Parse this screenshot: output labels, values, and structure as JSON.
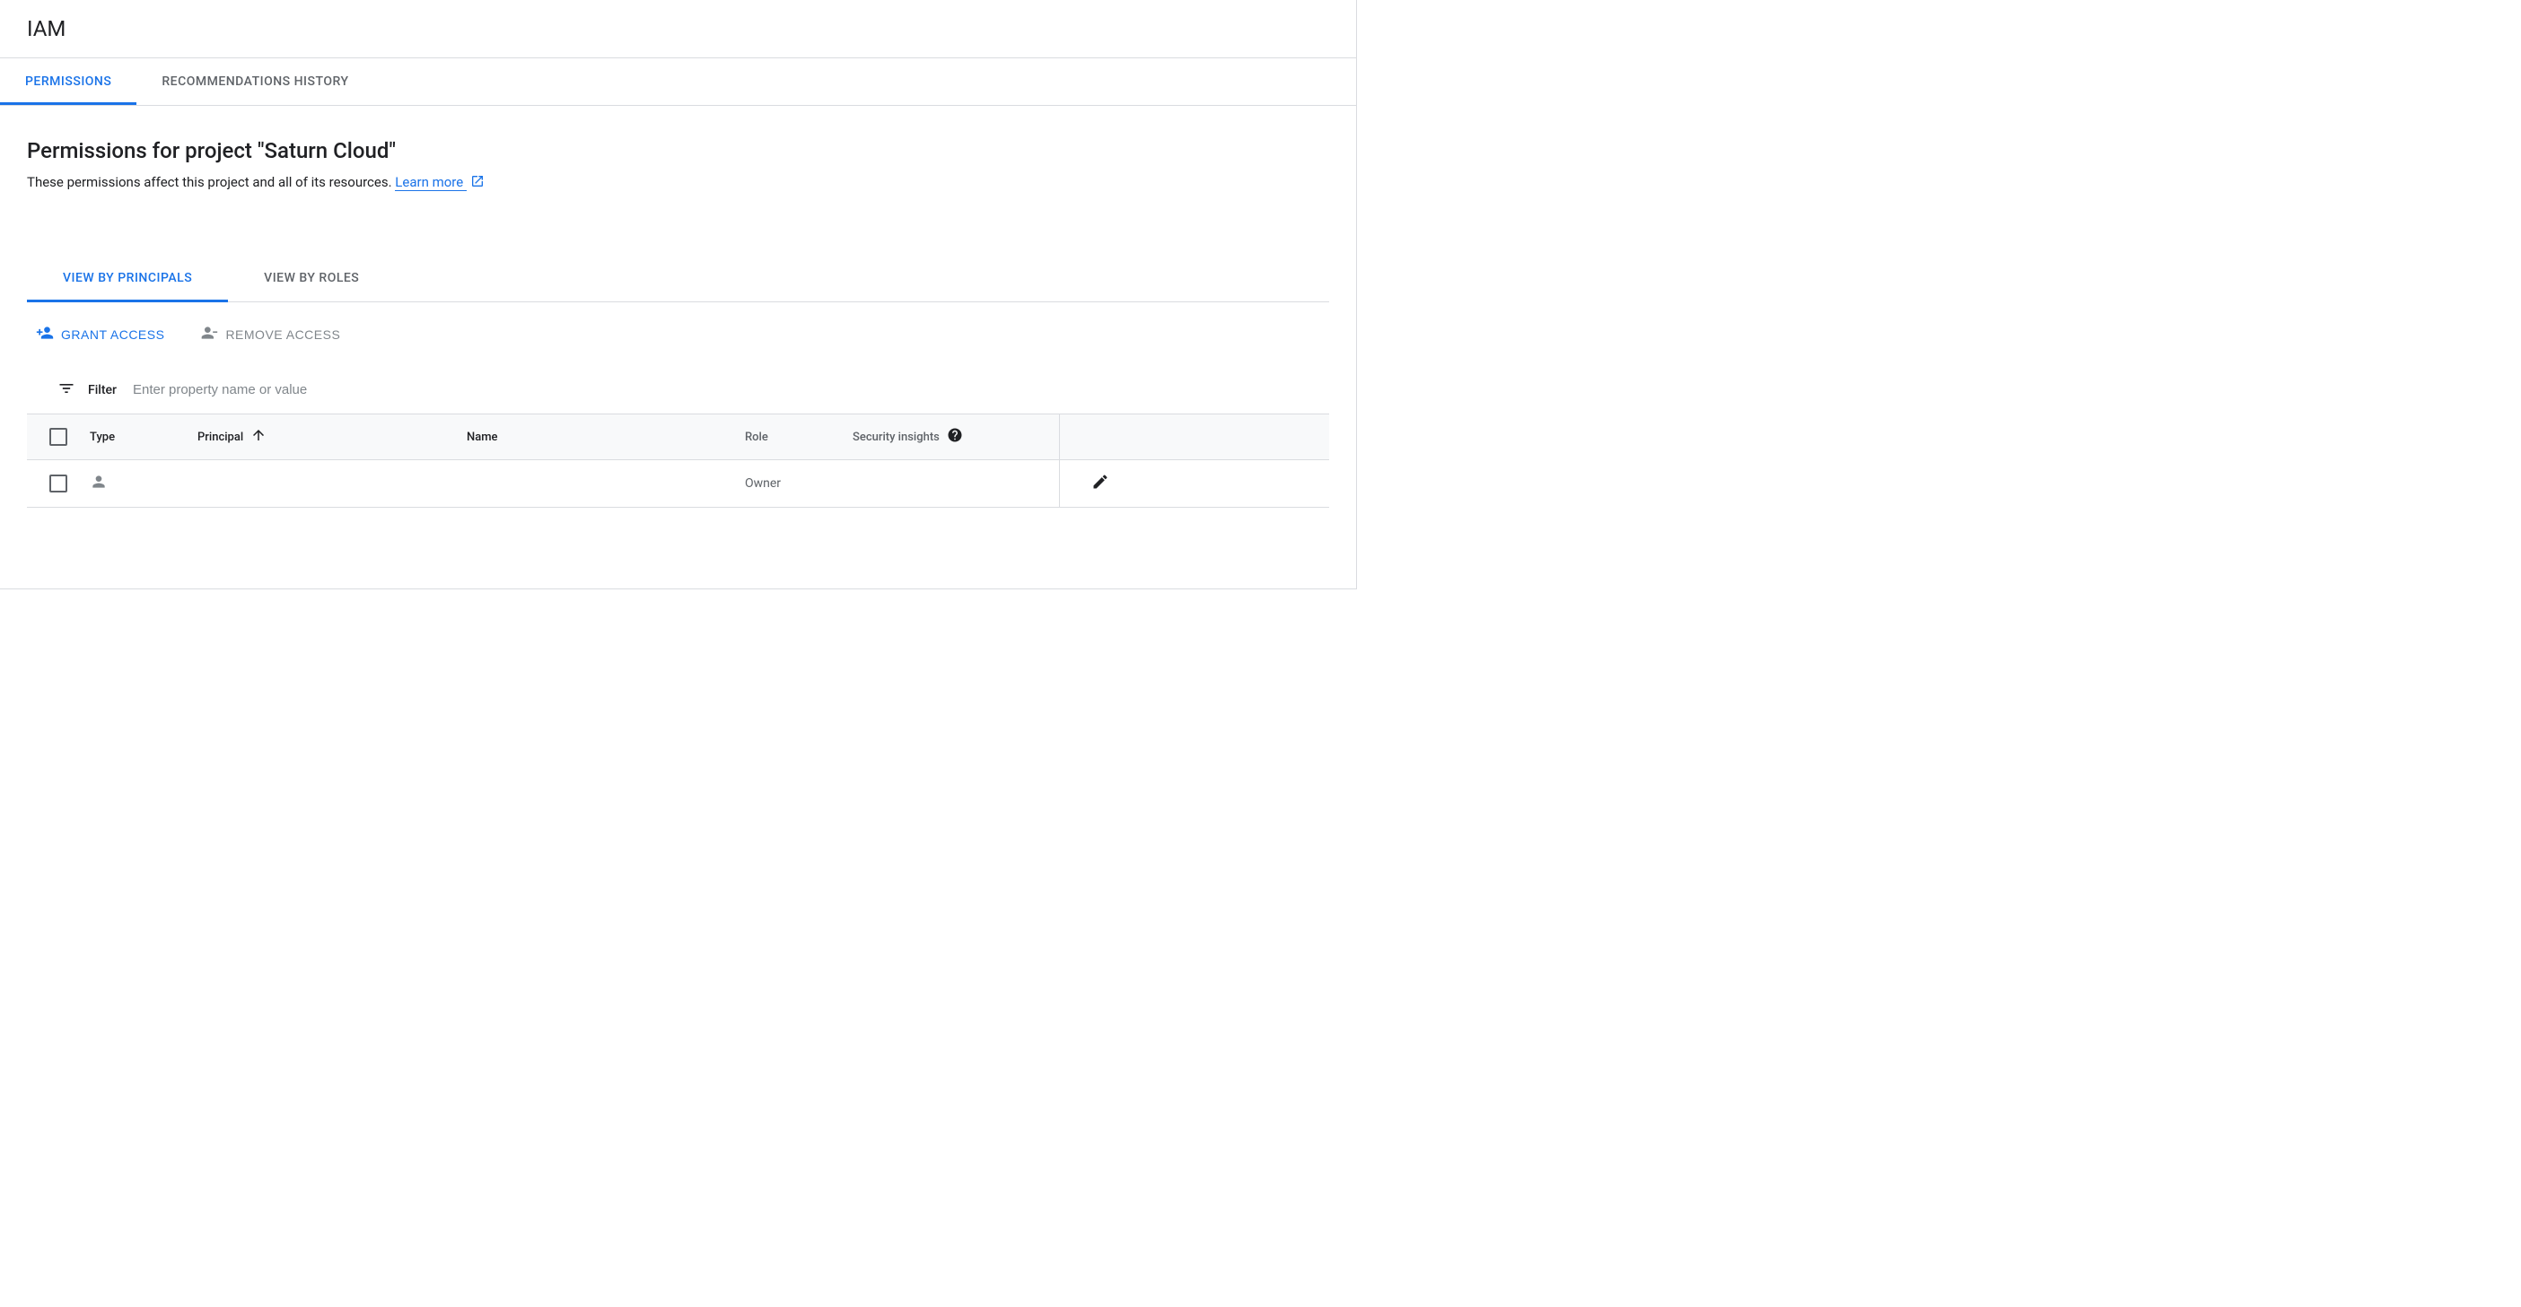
{
  "page_title": "IAM",
  "top_tabs": [
    {
      "label": "PERMISSIONS",
      "active": true
    },
    {
      "label": "RECOMMENDATIONS HISTORY",
      "active": false
    }
  ],
  "section": {
    "title": "Permissions for project \"Saturn Cloud\"",
    "description": "These permissions affect this project and all of its resources.",
    "learn_more": "Learn more"
  },
  "view_tabs": [
    {
      "label": "VIEW BY PRINCIPALS",
      "active": true
    },
    {
      "label": "VIEW BY ROLES",
      "active": false
    }
  ],
  "actions": {
    "grant": "GRANT ACCESS",
    "remove": "REMOVE ACCESS"
  },
  "filter": {
    "label": "Filter",
    "placeholder": "Enter property name or value"
  },
  "table": {
    "headers": {
      "type": "Type",
      "principal": "Principal",
      "name": "Name",
      "role": "Role",
      "insights": "Security insights"
    },
    "rows": [
      {
        "type": "",
        "principal": "",
        "name": "",
        "role": "Owner",
        "insights": ""
      }
    ]
  }
}
